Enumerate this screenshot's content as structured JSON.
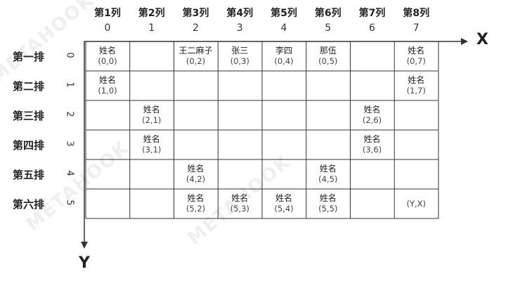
{
  "columns": [
    {
      "label": "第1列",
      "index": "0"
    },
    {
      "label": "第2列",
      "index": "1"
    },
    {
      "label": "第3列",
      "index": "2"
    },
    {
      "label": "第4列",
      "index": "3"
    },
    {
      "label": "第5列",
      "index": "4"
    },
    {
      "label": "第6列",
      "index": "5"
    },
    {
      "label": "第7列",
      "index": "6"
    },
    {
      "label": "第8列",
      "index": "7"
    }
  ],
  "rows": [
    {
      "label": "第一排",
      "index": "0"
    },
    {
      "label": "第二排",
      "index": "1"
    },
    {
      "label": "第三排",
      "index": "2"
    },
    {
      "label": "第四排",
      "index": "3"
    },
    {
      "label": "第五排",
      "index": "4"
    },
    {
      "label": "第六排",
      "index": "5"
    }
  ],
  "cells": [
    {
      "row": 0,
      "col": 0,
      "name": "姓名",
      "coord": "(0,0)"
    },
    {
      "row": 0,
      "col": 2,
      "name": "王二麻子",
      "coord": "(0,2)"
    },
    {
      "row": 0,
      "col": 3,
      "name": "张三",
      "coord": "(0,3)"
    },
    {
      "row": 0,
      "col": 4,
      "name": "李四",
      "coord": "(0,4)"
    },
    {
      "row": 0,
      "col": 5,
      "name": "那伍",
      "coord": "(0,5)"
    },
    {
      "row": 0,
      "col": 7,
      "name": "姓名",
      "coord": "(0,7)"
    },
    {
      "row": 1,
      "col": 0,
      "name": "姓名",
      "coord": "(1,0)"
    },
    {
      "row": 1,
      "col": 7,
      "name": "姓名",
      "coord": "(1,7)"
    },
    {
      "row": 2,
      "col": 1,
      "name": "姓名",
      "coord": "(2,1)"
    },
    {
      "row": 2,
      "col": 6,
      "name": "姓名",
      "coord": "(2,6)"
    },
    {
      "row": 3,
      "col": 1,
      "name": "姓名",
      "coord": "(3,1)"
    },
    {
      "row": 3,
      "col": 6,
      "name": "姓名",
      "coord": "(3,6)"
    },
    {
      "row": 4,
      "col": 2,
      "name": "姓名",
      "coord": "(4,2)"
    },
    {
      "row": 4,
      "col": 5,
      "name": "姓名",
      "coord": "(4,5)"
    },
    {
      "row": 5,
      "col": 2,
      "name": "姓名",
      "coord": "(5,2)"
    },
    {
      "row": 5,
      "col": 3,
      "name": "姓名",
      "coord": "(5,3)"
    },
    {
      "row": 5,
      "col": 4,
      "name": "姓名",
      "coord": "(5,4)"
    },
    {
      "row": 5,
      "col": 5,
      "name": "姓名",
      "coord": "(5,5)"
    },
    {
      "row": 5,
      "col": 7,
      "name": "",
      "coord": "(Y,X)"
    }
  ],
  "axes": {
    "x_label": "X",
    "y_label": "Y"
  },
  "watermark_text": "METAHOOK",
  "colors": {
    "grid": "#333333",
    "text": "#222222"
  }
}
